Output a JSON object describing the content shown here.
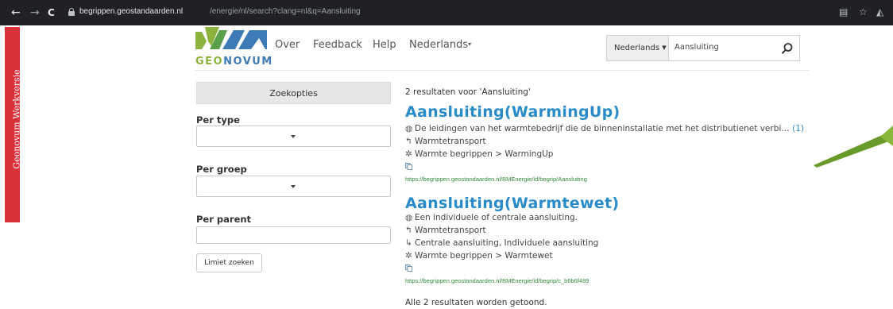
{
  "browser": {
    "back_icon": "←",
    "forward_icon": "→",
    "reload_icon": "C",
    "url_host": "begrippen.geostandaarden.nl",
    "url_path": "/energie/nl/search?clang=nl&q=Aansluiting"
  },
  "side_band": {
    "label": "Geonovum Werkversie",
    "color": "#d9303a"
  },
  "header": {
    "logo_text_1": "GEO",
    "logo_text_2": "NOVUM",
    "nav": {
      "over": "Over",
      "feedback": "Feedback",
      "help": "Help",
      "language": "Nederlands"
    },
    "search": {
      "language_button": "Nederlands",
      "query": "Aansluiting"
    }
  },
  "sidebar": {
    "zoekopties": "Zoekopties",
    "per_type": "Per type",
    "per_groep": "Per groep",
    "per_parent": "Per parent",
    "limiet_button": "Limiet zoeken"
  },
  "results": {
    "count_text": "2 resultaten voor 'Aansluiting'",
    "items": [
      {
        "title": "Aansluiting(WarmingUp)",
        "definition": "De leidingen van het warmtebedrijf die de binneninstallatie met het distributienet verbi…",
        "definition_count": "(1)",
        "broader": "Warmtetransport",
        "scheme": "Warmte begrippen > WarmingUp",
        "url": "https://begrippen.geostandaarden.nl/BMEnergie/id/begrip/Aansluiting"
      },
      {
        "title": "Aansluiting(Warmtewet)",
        "definition": "Een individuele of centrale aansluiting.",
        "broader": "Warmtetransport",
        "narrower": "Centrale aansluiting, Individuele aansluiting",
        "scheme": "Warmte begrippen > Warmtewet",
        "url": "https://begrippen.geostandaarden.nl/BMEnergie/id/begrip/c_b6b6f489"
      }
    ],
    "footer": "Alle 2 resultaten worden getoond."
  },
  "colors": {
    "accent": "#2a8bc9",
    "url_green": "#2f8a3a",
    "logo_green": "#8cb33d",
    "logo_blue": "#3e7bb6",
    "pointer_green": "#6a9a2a"
  }
}
